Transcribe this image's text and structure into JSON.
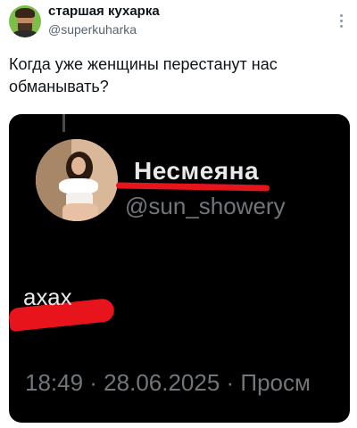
{
  "tweet": {
    "author_name": "старшая кухарка",
    "author_handle": "@superkuharka",
    "text": "Когда уже женщины перестанут нас обманывать?"
  },
  "screenshot": {
    "name": "Несмеяна",
    "handle": "@sun_showery",
    "text": "ахах",
    "meta": "18:49 · 28.06.2025 · Просм"
  },
  "colors": {
    "accent_red": "#e8141c",
    "dark_bg": "#000000",
    "muted_text": "#71767b"
  }
}
